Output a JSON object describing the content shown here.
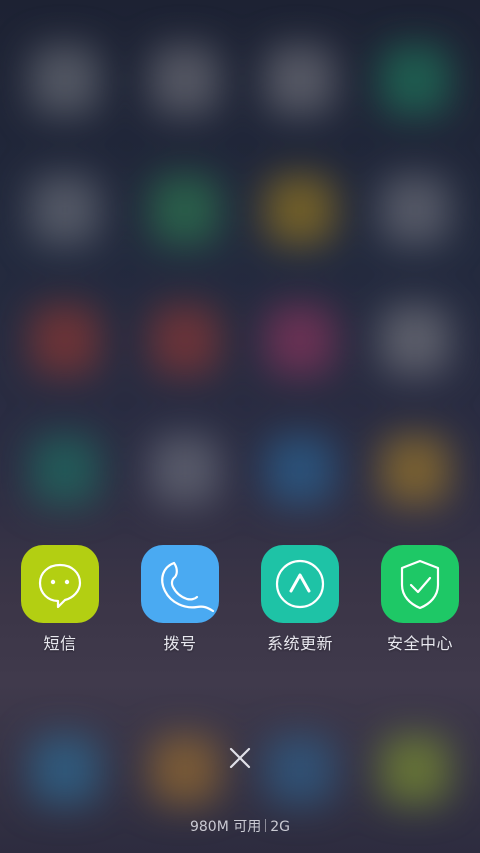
{
  "background": {
    "blur_tiles": [
      {
        "color": "#7c7f86"
      },
      {
        "color": "#7f8086"
      },
      {
        "color": "#84848a"
      },
      {
        "color": "#1f8a64"
      },
      {
        "color": "#7a7e87"
      },
      {
        "color": "#2f8a55"
      },
      {
        "color": "#b08b1c"
      },
      {
        "color": "#7e8088"
      },
      {
        "color": "#a53a30"
      },
      {
        "color": "#a33a33"
      },
      {
        "color": "#a03764"
      },
      {
        "color": "#87878d"
      },
      {
        "color": "#1c7d6a"
      },
      {
        "color": "#7a7e89"
      },
      {
        "color": "#2a6fa5"
      },
      {
        "color": "#b88b24"
      },
      {
        "color": "#2a79a8"
      },
      {
        "color": "#b07a2a"
      },
      {
        "color": "#2b6a9a"
      },
      {
        "color": "#8aa52b"
      }
    ]
  },
  "recent_apps": [
    {
      "label": "短信",
      "icon": "message-bubble-icon",
      "color": "#b3cf12"
    },
    {
      "label": "拨号",
      "icon": "phone-handset-icon",
      "color": "#4aaaf2"
    },
    {
      "label": "系统更新",
      "icon": "update-arrow-icon",
      "color": "#1ec3a6"
    },
    {
      "label": "安全中心",
      "icon": "shield-check-icon",
      "color": "#1ec866"
    }
  ],
  "close_icon": "close-icon",
  "memory": {
    "available": "980M 可用",
    "total": "2G"
  }
}
